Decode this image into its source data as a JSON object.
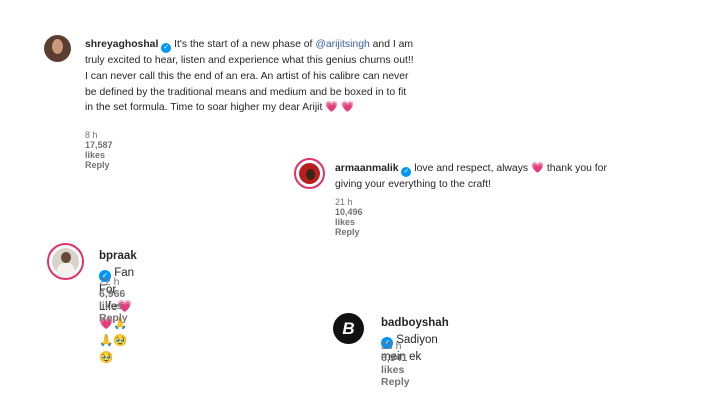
{
  "comments": [
    {
      "username": "shreyaghoshal",
      "text_before_mention": " It's the start of a new phase of ",
      "mention": "@arijitsingh",
      "text_after_mention": " and I am truly excited to hear, listen and experience what this genius churns out!! I can never call this the end of an era. An artist of his calibre can never be defined by the traditional means and medium and be boxed in to fit in the set formula. Time to soar higher my dear Arijit ",
      "emoji": "💗 💗",
      "time": "8 h",
      "likes": "17,587 likes",
      "reply": "Reply"
    },
    {
      "username": "armaanmalik",
      "text_before_emoji": " love and respect, always ",
      "emoji": "💗",
      "text_after_emoji": " thank you for giving your everything to the craft!",
      "time": "21 h",
      "likes": "10,496 likes",
      "reply": "Reply"
    },
    {
      "username": "bpraak",
      "text": " Fan For Life",
      "emoji": "💗💗🙏🙏🥹🥹",
      "time": "22 h",
      "likes": "6,966 likes",
      "reply": "Reply"
    },
    {
      "username": "badboyshah",
      "text": " Sadiyon mein ek",
      "avatar_letter": "B",
      "time": "23 h",
      "likes": "6,941 likes",
      "reply": "Reply"
    }
  ],
  "verified_glyph": "✓",
  "colors": {
    "verified": "#0095f6",
    "mention": "#3b5ea6",
    "heart": "#e8395b",
    "story_ring": "#e1306c",
    "meta": "#737373"
  },
  "icons": [
    "verified-badge-icon",
    "heart-emoji-icon",
    "folded-hands-emoji-icon"
  ]
}
